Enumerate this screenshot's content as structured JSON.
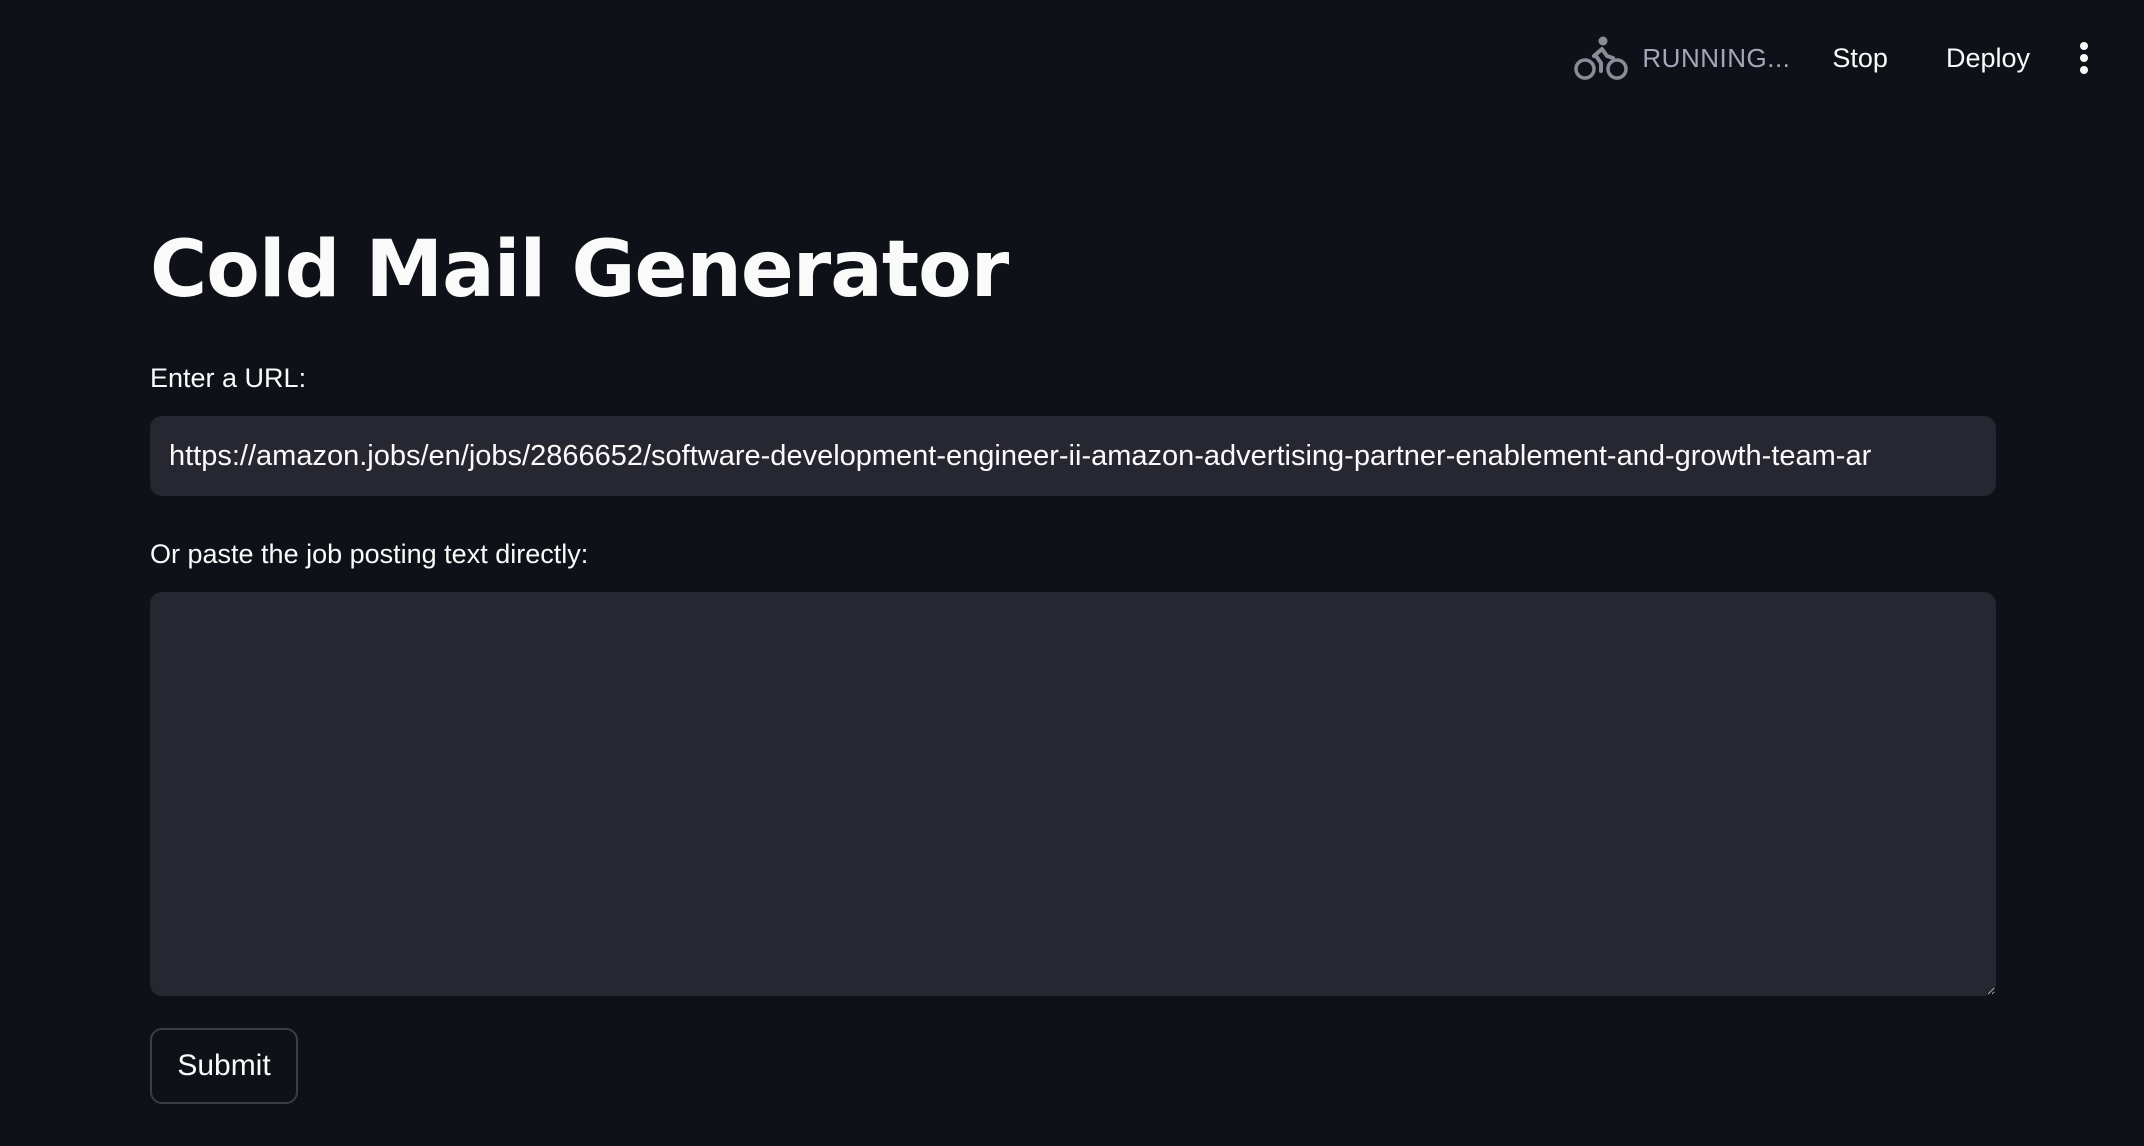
{
  "header": {
    "status_icon": "running-cyclist-icon",
    "status_label": "RUNNING...",
    "stop_label": "Stop",
    "deploy_label": "Deploy",
    "menu_icon": "kebab-menu-icon"
  },
  "main": {
    "title": "Cold Mail Generator",
    "url_field": {
      "label": "Enter a URL:",
      "value": "https://amazon.jobs/en/jobs/2866652/software-development-engineer-ii-amazon-advertising-partner-enablement-and-growth-team-ar"
    },
    "text_field": {
      "label": "Or paste the job posting text directly:",
      "value": ""
    },
    "submit_label": "Submit"
  },
  "colors": {
    "background": "#0e1117",
    "input_background": "#262730",
    "text": "#fafafa",
    "muted_text": "#a3a8b8"
  }
}
